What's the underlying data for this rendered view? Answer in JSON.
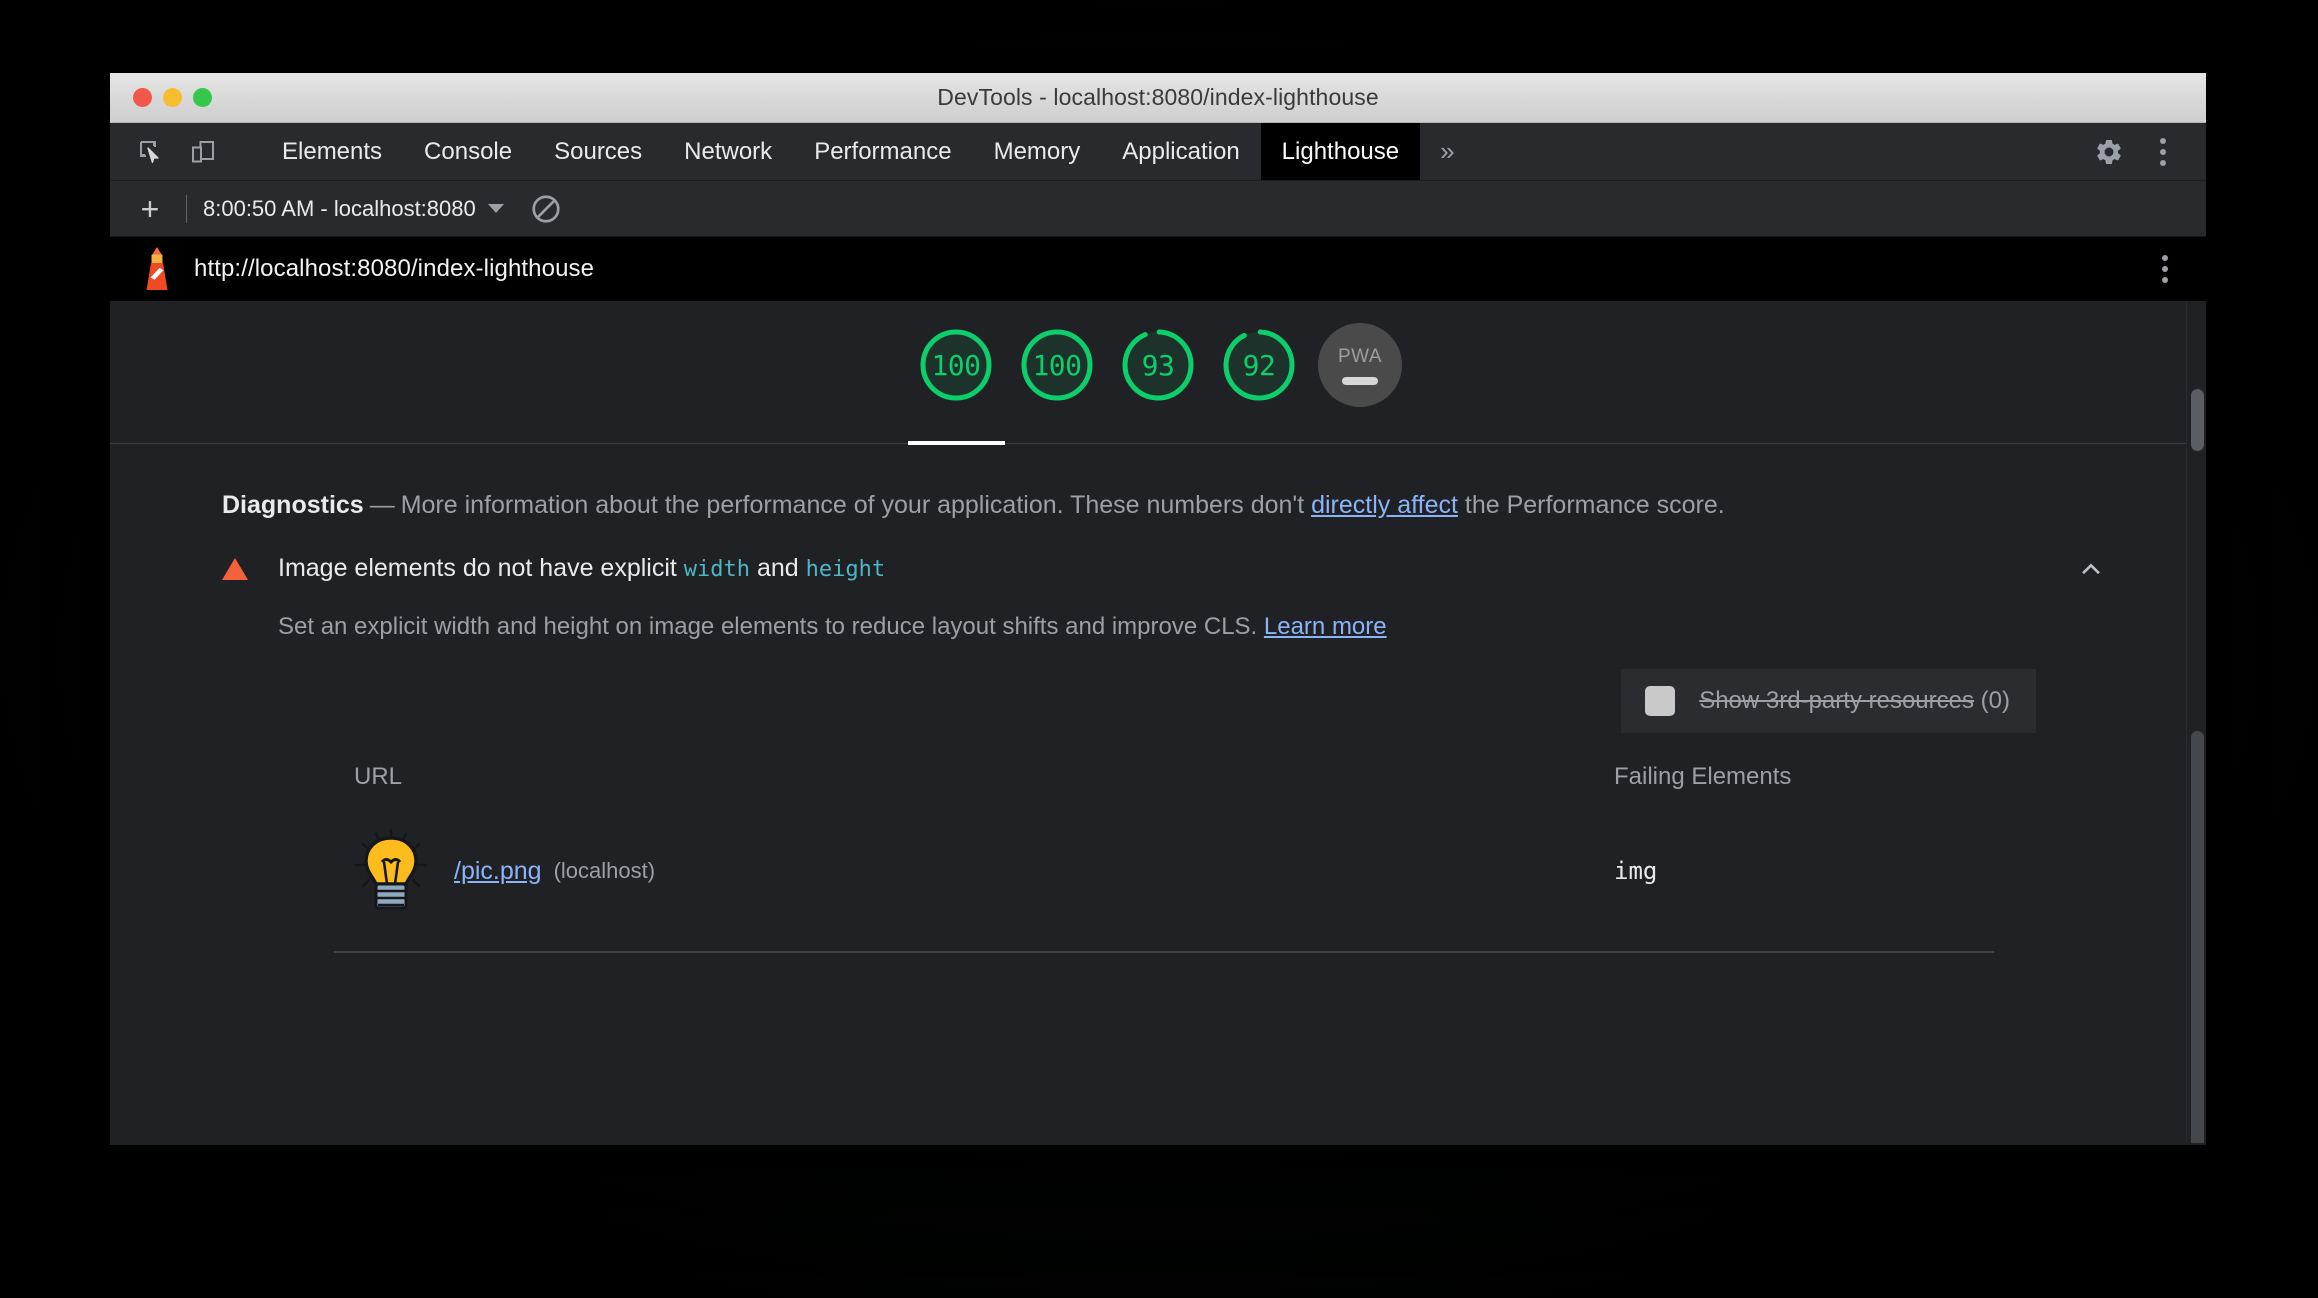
{
  "window": {
    "title": "DevTools - localhost:8080/index-lighthouse"
  },
  "tabbar": {
    "inspect_icon": "inspect-element-icon",
    "device_icon": "device-toolbar-icon",
    "tabs": [
      {
        "label": "Elements",
        "active": false
      },
      {
        "label": "Console",
        "active": false
      },
      {
        "label": "Sources",
        "active": false
      },
      {
        "label": "Network",
        "active": false
      },
      {
        "label": "Performance",
        "active": false
      },
      {
        "label": "Memory",
        "active": false
      },
      {
        "label": "Application",
        "active": false
      },
      {
        "label": "Lighthouse",
        "active": true
      }
    ],
    "overflow_label": "»",
    "settings_icon": "gear-icon",
    "menu_icon": "more-vertical-icon"
  },
  "lh_toolbar": {
    "add_label": "+",
    "run_label": "8:00:50 AM - localhost:8080",
    "clear_icon": "clear-no-entry-icon"
  },
  "report_header": {
    "logo_icon": "lighthouse-logo-icon",
    "url": "http://localhost:8080/index-lighthouse",
    "menu_icon": "more-vertical-icon"
  },
  "scores": {
    "gauges": [
      {
        "value": "100",
        "percent": 100,
        "active": true
      },
      {
        "value": "100",
        "percent": 100,
        "active": false
      },
      {
        "value": "93",
        "percent": 93,
        "active": false
      },
      {
        "value": "92",
        "percent": 92,
        "active": false
      }
    ],
    "pwa": {
      "label": "PWA",
      "state": "dash"
    },
    "color_pass": "#0cce6b"
  },
  "diagnostics": {
    "heading": "Diagnostics",
    "dash": "—",
    "text_before_link": "More information about the performance of your application. These numbers don't ",
    "link_label": "directly affect",
    "text_after_link": " the Performance score."
  },
  "audit": {
    "severity_icon": "warning-triangle-icon",
    "severity_color": "#f4623c",
    "title_part1": "Image elements do not have explicit ",
    "code1": "width",
    "title_part2": " and ",
    "code2": "height",
    "collapse_icon": "chevron-up-icon",
    "description": "Set an explicit width and height on image elements to reduce layout shifts and improve CLS. ",
    "learn_more_label": "Learn more",
    "third_party": {
      "checked": false,
      "struck_label": "Show 3rd-party resources",
      "count_label": "(0)"
    },
    "table": {
      "columns": [
        "URL",
        "Failing Elements"
      ],
      "rows": [
        {
          "thumbnail_icon": "lightbulb-image-thumbnail",
          "url": "/pic.png",
          "host": "(localhost)",
          "failing_element": "img"
        }
      ]
    }
  }
}
